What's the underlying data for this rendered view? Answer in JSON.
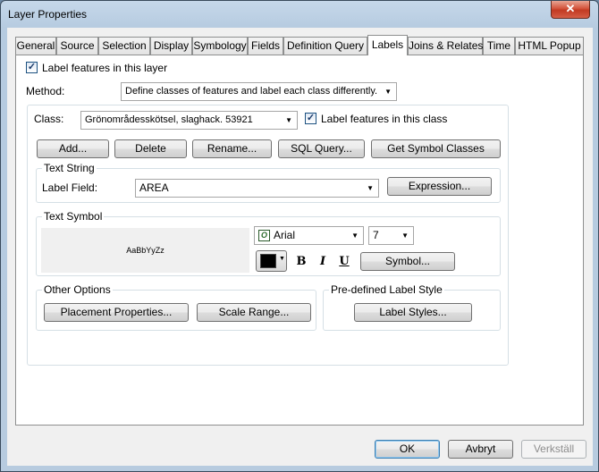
{
  "window": {
    "title": "Layer Properties",
    "close_glyph": "✕"
  },
  "tabs": [
    {
      "label": "General"
    },
    {
      "label": "Source"
    },
    {
      "label": "Selection"
    },
    {
      "label": "Display"
    },
    {
      "label": "Symbology"
    },
    {
      "label": "Fields"
    },
    {
      "label": "Definition Query"
    },
    {
      "label": "Labels",
      "active": true
    },
    {
      "label": "Joins & Relates"
    },
    {
      "label": "Time"
    },
    {
      "label": "HTML Popup"
    }
  ],
  "labels_tab": {
    "label_features_layer": {
      "label": "Label features in this layer",
      "checked": true
    },
    "method": {
      "label": "Method:",
      "value": "Define classes of features and label each class differently."
    },
    "class": {
      "label": "Class:",
      "value": "Grönområdesskötsel, slaghack. 53921",
      "label_features_class": {
        "label": "Label features in this class",
        "checked": true
      }
    },
    "class_buttons": {
      "add": "Add...",
      "delete": "Delete",
      "rename": "Rename...",
      "sql_query": "SQL Query...",
      "get_symbol_classes": "Get Symbol Classes"
    },
    "text_string": {
      "title": "Text String",
      "label_field_label": "Label Field:",
      "label_field_value": "AREA",
      "expression_button": "Expression..."
    },
    "text_symbol": {
      "title": "Text Symbol",
      "preview_text": "AaBbYyZz",
      "font": "Arial",
      "size": "7",
      "color": "#000000",
      "bold": "B",
      "italic": "I",
      "underline": "U",
      "symbol_button": "Symbol..."
    },
    "other_options": {
      "title": "Other Options",
      "placement_button": "Placement Properties...",
      "scale_range_button": "Scale Range..."
    },
    "predefined": {
      "title": "Pre-defined Label Style",
      "label_styles_button": "Label Styles..."
    }
  },
  "footer": {
    "ok": "OK",
    "cancel": "Avbryt",
    "apply": "Verkställ"
  }
}
